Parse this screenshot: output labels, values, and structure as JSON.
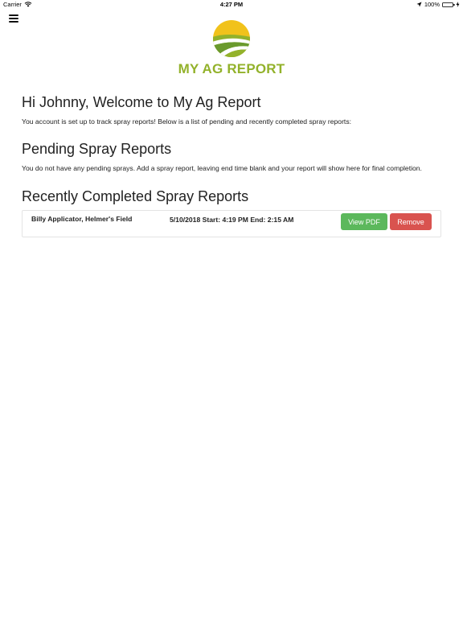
{
  "status_bar": {
    "carrier": "Carrier",
    "time": "4:27 PM",
    "battery": "100%",
    "battery_level": 1.0,
    "icons": [
      "wifi-icon",
      "location-arrow-icon",
      "battery-icon",
      "charging-bolt-icon"
    ]
  },
  "header": {
    "menu_icon": "hamburger-menu-icon",
    "logo_text": "MY AG REPORT",
    "colors": {
      "logo_green": "#93b22b",
      "logo_yellow": "#f1c21b",
      "logo_dark_green": "#6a9a2c"
    }
  },
  "welcome": {
    "title": "Hi Johnny, Welcome to My Ag Report",
    "text": "You account is set up to track spray reports! Below is a list of pending and recently completed spray reports:"
  },
  "pending": {
    "title": "Pending Spray Reports",
    "text": "You do not have any pending sprays. Add a spray report, leaving end time blank and your report will show here for final completion."
  },
  "recent": {
    "title": "Recently Completed Spray Reports",
    "rows": [
      {
        "name": "Billy Applicator, Helmer's Field",
        "time": "5/10/2018 Start: 4:19 PM End: 2:15 AM",
        "view_label": "View PDF",
        "remove_label": "Remove"
      }
    ],
    "colors": {
      "view_button": "#5cb85c",
      "remove_button": "#d9534f"
    }
  }
}
